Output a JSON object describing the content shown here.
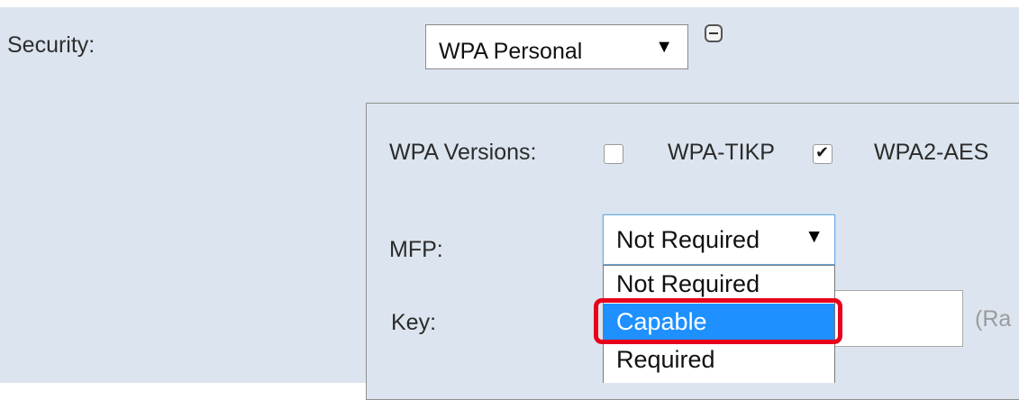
{
  "security": {
    "label": "Security:",
    "selected": "WPA Personal",
    "arrow": "▼",
    "expand_icon": "collapse-minus-icon"
  },
  "wpa_versions": {
    "label": "WPA Versions:",
    "options": [
      {
        "label": "",
        "checked": false
      },
      {
        "label": "WPA-TIKP",
        "checked": true
      },
      {
        "label": "WPA2-AES",
        "checked": false
      }
    ]
  },
  "mfp": {
    "label": "MFP:",
    "selected": "Not Required",
    "arrow": "▼",
    "options": [
      "Not Required",
      "Capable",
      "Required"
    ],
    "highlighted": "Capable"
  },
  "key": {
    "label": "Key:",
    "value": "",
    "hint": "(Ra"
  },
  "colors": {
    "panel_bg": "#dce5ef",
    "highlight_blue": "#1e90ff",
    "annotation_red": "#e8001c"
  }
}
